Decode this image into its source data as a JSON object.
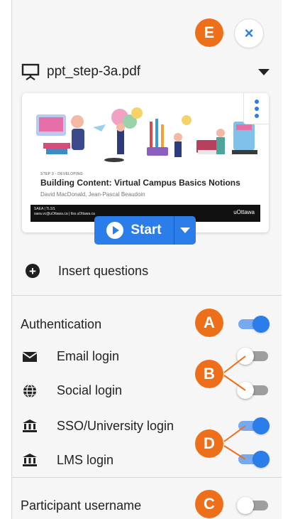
{
  "callouts": {
    "a": "A",
    "b": "B",
    "c": "C",
    "d": "D",
    "e": "E"
  },
  "header": {
    "close_label": "×"
  },
  "file": {
    "name": "ppt_step-3a.pdf",
    "icon": "presentation-icon"
  },
  "slide": {
    "step": "STEP 3 - DEVELOPING",
    "title": "Building Content: Virtual Campus Basics Notions",
    "authors": "David MacDonald, Jean-Pascal Beaudoin",
    "footer_line1": "SAEA | TLSS",
    "footer_line2": "saea.vc@uOttawa.ca | tlss.uOttawa.ca",
    "brand": "uOttawa"
  },
  "start": {
    "label": "Start"
  },
  "insert": {
    "label": "Insert questions"
  },
  "auth": {
    "label": "Authentication",
    "enabled": true,
    "options": [
      {
        "label": "Email login",
        "icon": "envelope-icon",
        "enabled": false
      },
      {
        "label": "Social login",
        "icon": "globe-icon",
        "enabled": false
      },
      {
        "label": "SSO/University login",
        "icon": "institution-icon",
        "enabled": true
      },
      {
        "label": "LMS login",
        "icon": "institution-icon",
        "enabled": true
      }
    ]
  },
  "participant": {
    "label": "Participant username",
    "enabled": false
  },
  "colors": {
    "accent": "#2b7de9",
    "callout": "#ee6f1a",
    "toggle_on_track": "#76a9f0",
    "toggle_off_track": "#9e9e9e"
  }
}
